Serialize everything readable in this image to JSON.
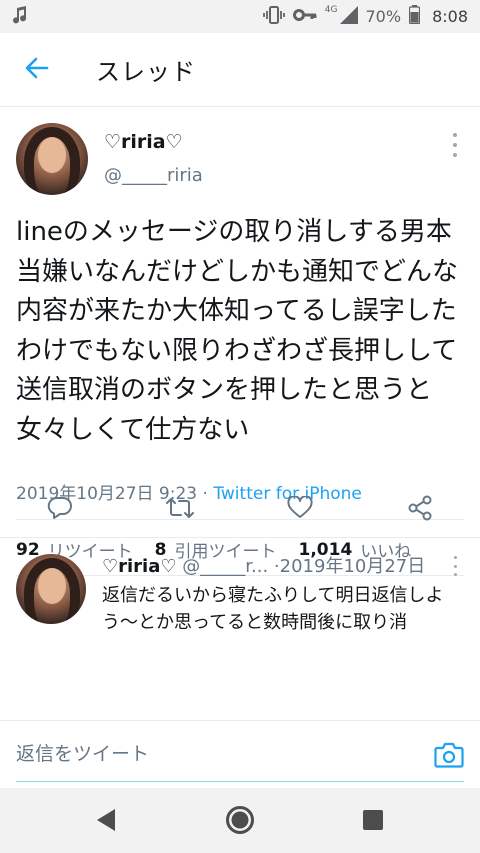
{
  "status_bar": {
    "network": "4G",
    "battery": "70%",
    "time": "8:08"
  },
  "header": {
    "title": "スレッド"
  },
  "tweet": {
    "author_name": "♡riria♡",
    "author_handle": "@_____riria",
    "text": "lineのメッセージの取り消しする男本当嫌いなんだけどしかも通知でどんな内容が来たか大体知ってるし誤字したわけでもない限りわざわざ長押しして送信取消のボタンを押したと思うと女々しくて仕方ない",
    "date": "2019年10月27日 9:23",
    "source_sep": " · ",
    "source": "Twitter for iPhone",
    "retweets": "92",
    "retweets_label": "リツイート",
    "quotes": "8",
    "quotes_label": "引用ツイート",
    "likes": "1,014",
    "likes_label": "いいね"
  },
  "reply": {
    "name": "♡riria♡",
    "handle": "@_____r...",
    "dot": "·",
    "date": "2019年10月27日",
    "text": "返信だるいから寝たふりして明日返信しよう〜とか思ってると数時間後に取り消"
  },
  "reply_bar": {
    "placeholder": "返信をツイート"
  },
  "colors": {
    "accent": "#1da1f2",
    "text": "#14171a",
    "secondary": "#657786",
    "divider": "#e6ecf0"
  }
}
